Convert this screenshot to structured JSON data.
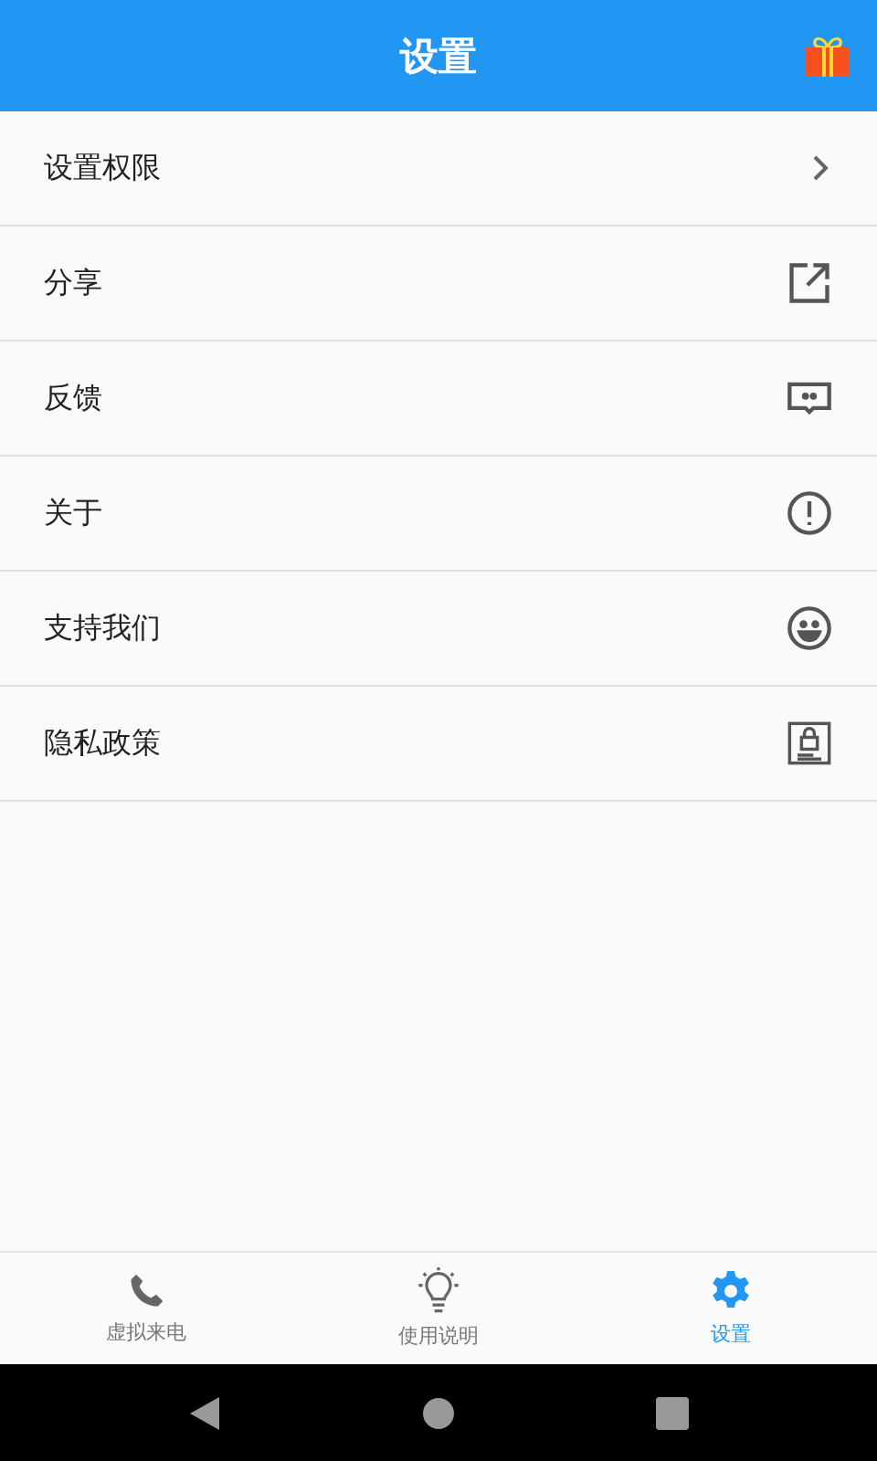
{
  "header": {
    "title": "设置"
  },
  "menu": [
    {
      "label": "设置权限",
      "kind": "chevron"
    },
    {
      "label": "分享",
      "kind": "share"
    },
    {
      "label": "反馈",
      "kind": "feedback"
    },
    {
      "label": "关于",
      "kind": "info"
    },
    {
      "label": "支持我们",
      "kind": "smile"
    },
    {
      "label": "隐私政策",
      "kind": "privacy"
    }
  ],
  "tabs": [
    {
      "label": "虚拟来电",
      "kind": "phone",
      "selected": false
    },
    {
      "label": "使用说明",
      "kind": "bulb",
      "selected": false
    },
    {
      "label": "设置",
      "kind": "gear",
      "selected": true
    }
  ]
}
